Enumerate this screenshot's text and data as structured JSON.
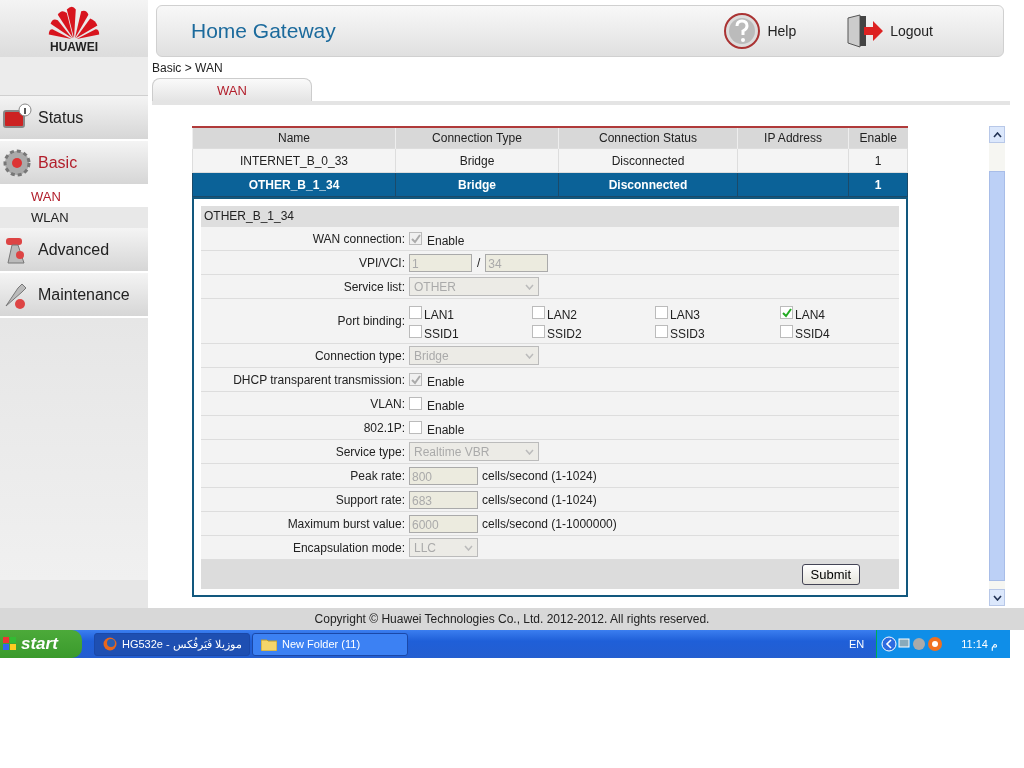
{
  "logo": {
    "text": "HUAWEI"
  },
  "header": {
    "title": "Home Gateway",
    "links": [
      {
        "label": "Help",
        "kind": "help"
      },
      {
        "label": "Logout",
        "kind": "logout"
      }
    ]
  },
  "sidebar": {
    "items": [
      {
        "label": "Status",
        "kind": "status",
        "selected": false
      },
      {
        "label": "Basic",
        "kind": "basic",
        "selected": true,
        "children": [
          {
            "label": "WAN",
            "selected": true
          },
          {
            "label": "WLAN",
            "selected": false
          }
        ]
      },
      {
        "label": "Advanced",
        "kind": "advanced",
        "selected": false
      },
      {
        "label": "Maintenance",
        "kind": "maintenance",
        "selected": false
      }
    ]
  },
  "breadcrumb": "Basic > WAN",
  "tabs": [
    {
      "label": "WAN",
      "selected": true
    }
  ],
  "table": {
    "columns": [
      "Name",
      "Connection Type",
      "Connection Status",
      "IP Address",
      "Enable"
    ],
    "rows": [
      {
        "cells": [
          "INTERNET_B_0_33",
          "Bridge",
          "Disconnected",
          "",
          "1"
        ],
        "selected": false
      },
      {
        "cells": [
          "OTHER_B_1_34",
          "Bridge",
          "Disconnected",
          "",
          "1"
        ],
        "selected": true
      }
    ]
  },
  "detail": {
    "title": "OTHER_B_1_34",
    "fields": [
      {
        "kind": "checkbox",
        "label": "WAN connection:",
        "option": "Enable",
        "checked": true,
        "disabled": true
      },
      {
        "kind": "pair",
        "label": "VPI/VCI:",
        "values": [
          "1",
          "34"
        ],
        "separator": "/"
      },
      {
        "kind": "select",
        "label": "Service list:",
        "value": "OTHER"
      },
      {
        "kind": "ports",
        "label": "Port binding:",
        "ports": [
          {
            "label": "LAN1",
            "checked": false
          },
          {
            "label": "LAN2",
            "checked": false
          },
          {
            "label": "LAN3",
            "checked": false
          },
          {
            "label": "LAN4",
            "checked": true
          },
          {
            "label": "SSID1",
            "checked": false
          },
          {
            "label": "SSID2",
            "checked": false
          },
          {
            "label": "SSID3",
            "checked": false
          },
          {
            "label": "SSID4",
            "checked": false
          }
        ]
      },
      {
        "kind": "select",
        "label": "Connection type:",
        "value": "Bridge"
      },
      {
        "kind": "checkbox",
        "label": "DHCP transparent transmission:",
        "option": "Enable",
        "checked": true,
        "disabled": true
      },
      {
        "kind": "checkbox",
        "label": "VLAN:",
        "option": "Enable",
        "checked": false,
        "disabled": false
      },
      {
        "kind": "checkbox",
        "label": "802.1P:",
        "option": "Enable",
        "checked": false,
        "disabled": false
      },
      {
        "kind": "select",
        "label": "Service type:",
        "value": "Realtime VBR"
      },
      {
        "kind": "input",
        "label": "Peak rate:",
        "value": "800",
        "unit": "cells/second (1-1024)"
      },
      {
        "kind": "input",
        "label": "Support rate:",
        "value": "683",
        "unit": "cells/second (1-1024)"
      },
      {
        "kind": "input",
        "label": "Maximum burst value:",
        "value": "6000",
        "unit": "cells/second (1-1000000)"
      },
      {
        "kind": "shortselect",
        "label": "Encapsulation mode:",
        "value": "LLC"
      }
    ],
    "submit": "Submit"
  },
  "footer": "Copyright © Huawei Technologies Co., Ltd. 2012-2012. All rights reserved.",
  "taskbar": {
    "start": "start",
    "tasks": [
      {
        "label": "HG532e - موزيلا فَيَرفُكس",
        "kind": "browser",
        "selected": true
      },
      {
        "label": "New Folder (11)",
        "kind": "folder",
        "selected": false
      }
    ],
    "language": "EN",
    "clock": "11:14 م"
  }
}
